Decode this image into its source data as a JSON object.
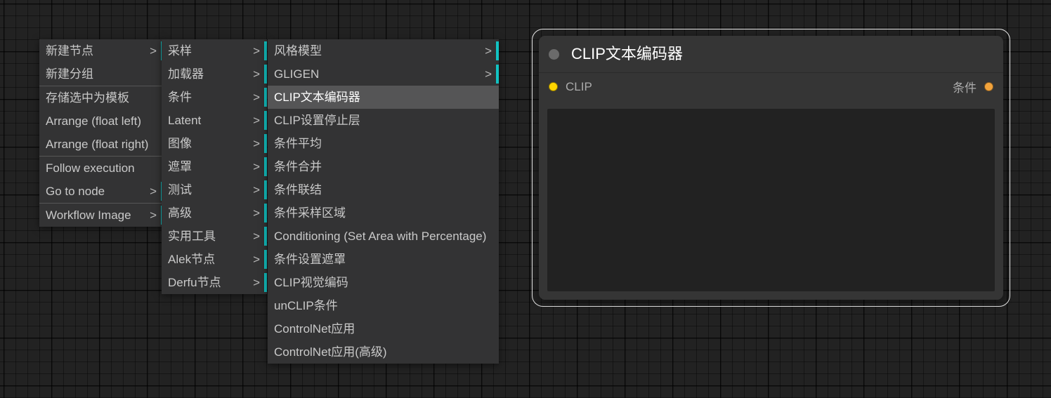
{
  "canvas": {
    "background_color": "#222222",
    "grid_color": "#1a1a1a"
  },
  "context_menu": {
    "accent_color": "#12c2c2",
    "submenu_arrow": ">",
    "columns": [
      {
        "name": "root",
        "items": [
          {
            "label": "新建节点",
            "has_submenu": true,
            "separator_after": false
          },
          {
            "label": "新建分组",
            "has_submenu": false,
            "separator_after": true
          },
          {
            "label": "存储选中为模板",
            "has_submenu": false,
            "separator_after": false
          },
          {
            "label": "Arrange (float left)",
            "has_submenu": false,
            "separator_after": false
          },
          {
            "label": "Arrange (float right)",
            "has_submenu": false,
            "separator_after": true
          },
          {
            "label": "Follow execution",
            "has_submenu": false,
            "separator_after": false
          },
          {
            "label": "Go to node",
            "has_submenu": true,
            "separator_after": true
          },
          {
            "label": "Workflow Image",
            "has_submenu": true,
            "separator_after": false
          }
        ]
      },
      {
        "name": "categories",
        "items": [
          {
            "label": "采样",
            "has_submenu": true
          },
          {
            "label": "加载器",
            "has_submenu": true
          },
          {
            "label": "条件",
            "has_submenu": true
          },
          {
            "label": "Latent",
            "has_submenu": true
          },
          {
            "label": "图像",
            "has_submenu": true
          },
          {
            "label": "遮罩",
            "has_submenu": true
          },
          {
            "label": "测试",
            "has_submenu": true
          },
          {
            "label": "高级",
            "has_submenu": true
          },
          {
            "label": "实用工具",
            "has_submenu": true
          },
          {
            "label": "Alek节点",
            "has_submenu": true
          },
          {
            "label": "Derfu节点",
            "has_submenu": true
          }
        ]
      },
      {
        "name": "conditioning-nodes",
        "items": [
          {
            "label": "风格模型",
            "has_submenu": true,
            "selected": false
          },
          {
            "label": "GLIGEN",
            "has_submenu": true,
            "selected": false
          },
          {
            "label": "CLIP文本编码器",
            "has_submenu": false,
            "selected": true
          },
          {
            "label": "CLIP设置停止层",
            "has_submenu": false,
            "selected": false
          },
          {
            "label": "条件平均",
            "has_submenu": false,
            "selected": false
          },
          {
            "label": "条件合并",
            "has_submenu": false,
            "selected": false
          },
          {
            "label": "条件联结",
            "has_submenu": false,
            "selected": false
          },
          {
            "label": "条件采样区域",
            "has_submenu": false,
            "selected": false
          },
          {
            "label": "Conditioning (Set Area with Percentage)",
            "has_submenu": false,
            "selected": false
          },
          {
            "label": "条件设置遮罩",
            "has_submenu": false,
            "selected": false
          },
          {
            "label": "CLIP视觉编码",
            "has_submenu": false,
            "selected": false
          },
          {
            "label": "unCLIP条件",
            "has_submenu": false,
            "selected": false
          },
          {
            "label": "ControlNet应用",
            "has_submenu": false,
            "selected": false
          },
          {
            "label": "ControlNet应用(高级)",
            "has_submenu": false,
            "selected": false
          }
        ]
      }
    ]
  },
  "node": {
    "title": "CLIP文本编码器",
    "selected": true,
    "collapse_dot_color": "#6b6b6b",
    "header_color": "#353535",
    "body_color": "#353535",
    "inputs": [
      {
        "name": "CLIP",
        "label": "CLIP",
        "color": "#ffd500"
      }
    ],
    "outputs": [
      {
        "name": "条件",
        "label": "条件",
        "color": "#f2a33c"
      }
    ],
    "text_widget": {
      "value": "",
      "placeholder": ""
    }
  }
}
